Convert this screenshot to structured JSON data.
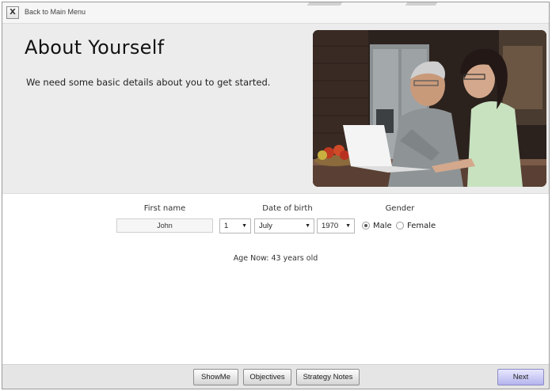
{
  "topbar": {
    "close_label": "X",
    "back_label": "Back to Main Menu"
  },
  "hero": {
    "title": "About Yourself",
    "subtitle": "We need some basic details about you to get started."
  },
  "form": {
    "first_name_label": "First name",
    "first_name_value": "John",
    "dob_label": "Date of birth",
    "dob_day": "1",
    "dob_month": "July",
    "dob_year": "1970",
    "gender_label": "Gender",
    "gender_options": [
      "Male",
      "Female"
    ],
    "gender_selected": "Male",
    "age_text": "Age Now: 43 years old"
  },
  "footer": {
    "showme_label": "ShowMe",
    "objectives_label": "Objectives",
    "strategy_label": "Strategy Notes",
    "next_label": "Next"
  },
  "icons": {
    "dropdown_arrow": "chevron-down-icon"
  },
  "colors": {
    "hero_background": "#ececec",
    "next_button": "#b4b4ee"
  }
}
